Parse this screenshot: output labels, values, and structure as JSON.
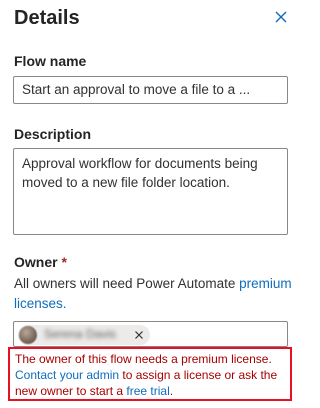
{
  "panel": {
    "title": "Details",
    "close_icon": "close-icon"
  },
  "flow_name": {
    "label": "Flow name",
    "value": "Start an approval to move a file to a ..."
  },
  "description": {
    "label": "Description",
    "value": "Approval workflow for documents being moved to a new file folder location."
  },
  "owner": {
    "label": "Owner",
    "required_marker": "*",
    "note_text": "All owners will need Power Automate ",
    "note_link": "premium licenses.",
    "chip_name": "Serena Davis",
    "chip_remove_icon": "close-icon"
  },
  "error": {
    "line1": "The owner of this flow needs a premium license.",
    "contact_link": "Contact your admin",
    "line2_mid": " to assign a license or ask the new owner to start a ",
    "trial_link": "free trial",
    "end": "."
  },
  "colors": {
    "link": "#0f6cbd",
    "error_text": "#a80000",
    "error_border": "#e81123",
    "required": "#a4262c"
  }
}
